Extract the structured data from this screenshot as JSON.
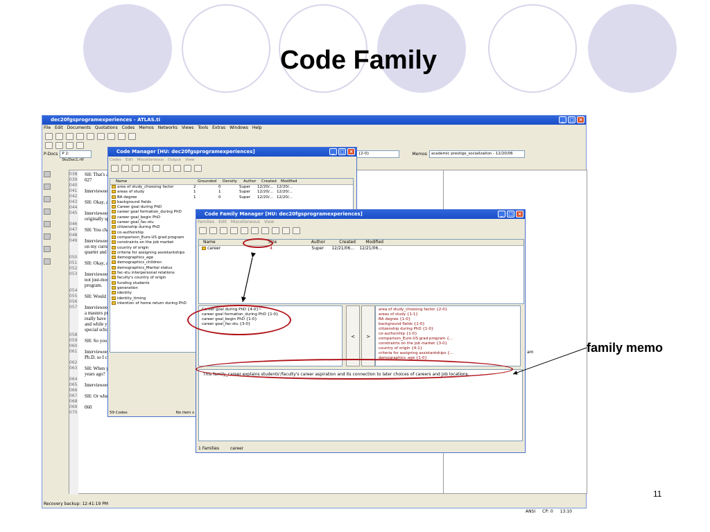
{
  "slide": {
    "title": "Code Family",
    "page_number": "11",
    "callout": "family memo"
  },
  "app": {
    "title": "dec20fgsprogramexperiences - ATLAS.ti",
    "menu": [
      "File",
      "Edit",
      "Documents",
      "Quotations",
      "Codes",
      "Memos",
      "Networks",
      "Views",
      "Tools",
      "Extras",
      "Windows",
      "Help"
    ],
    "pdocs_label": "P-Docs",
    "pdoc_value": "P 2: StuDoc1.rtf",
    "codes_combo": "area of study_choosing factor {2-0}",
    "memos_label": "Memos",
    "memo_combo": "academic prestige_socialization - 12/20/06",
    "status_left": "Recovery backup: 12:41:19 PM",
    "status_right": [
      "ANSI",
      "CP: 0",
      "13:10"
    ],
    "line_numbers": [
      "038",
      "039",
      "040",
      "041",
      "042",
      "043",
      "044",
      "045",
      "",
      "046",
      "047",
      "048",
      "049",
      "",
      "",
      "050",
      "051",
      "052",
      "053",
      "",
      "",
      "054",
      "055",
      "056",
      "057",
      "",
      "",
      "",
      "",
      "058",
      "059",
      "060",
      "061",
      "",
      "062",
      "063",
      "",
      "064",
      "065",
      "066",
      "067",
      "068",
      "069",
      "070"
    ],
    "doc_lines": [
      "SH: That's a",
      "027",
      "",
      "Interviewee:",
      "",
      "SH: Okay, ar",
      "",
      "Interviewee:",
      "originally spe",
      "",
      "SH: You cha",
      "",
      "Interviewee:",
      "on my curren",
      "quarter and t",
      "",
      "SH: Okay, ar",
      "",
      "Interviewee:",
      "not just-most",
      "program.",
      "",
      "SH: Would y",
      "",
      "Interviewee:",
      "a masters pro",
      "really have d",
      "and while yo",
      "special schoo",
      "",
      "SH: So you c",
      "",
      "Interviewee:",
      "Ph.D. so I came, yeah.",
      "",
      "SH: When you apply your, well, let me ask in th",
      "years ago?",
      "",
      "Interviewee: um (yes).",
      "",
      "SH: Or when you apply your MA even?",
      "",
      "060",
      ""
    ],
    "right_pane_fragment": "am"
  },
  "code_manager": {
    "title": "Code Manager [HU: dec20fgsprogramexperiences]",
    "menu": [
      "Codes",
      "Edit",
      "Miscellaneous",
      "Output",
      "View"
    ],
    "columns": [
      "Name",
      "Grounded",
      "Density",
      "Author",
      "Created",
      "Modified"
    ],
    "rows": [
      [
        "area of study_choosing factor",
        "2",
        "0",
        "Super",
        "12/20/...",
        "12/20/..."
      ],
      [
        "areas of study",
        "1",
        "1",
        "Super",
        "12/20/...",
        "12/20/..."
      ],
      [
        "BA degree",
        "1",
        "0",
        "Super",
        "12/20/...",
        "12/20/..."
      ],
      [
        "background fields",
        "",
        "",
        "",
        "",
        ""
      ],
      [
        "Career goal during PhD",
        "",
        "",
        "",
        "",
        ""
      ],
      [
        "career goal formation_during PhD",
        "",
        "",
        "",
        "",
        ""
      ],
      [
        "career goal_begin PhD",
        "",
        "",
        "",
        "",
        ""
      ],
      [
        "career goal_fac-stu",
        "",
        "",
        "",
        "",
        ""
      ],
      [
        "citizenship during PhD",
        "",
        "",
        "",
        "",
        ""
      ],
      [
        "co-authorship",
        "",
        "",
        "",
        "",
        ""
      ],
      [
        "comparison_Euro-US grad program",
        "",
        "",
        "",
        "",
        ""
      ],
      [
        "constraints on the job market",
        "",
        "",
        "",
        "",
        ""
      ],
      [
        "country of origin",
        "",
        "",
        "",
        "",
        ""
      ],
      [
        "criteria for assigning assistantships",
        "",
        "",
        "",
        "",
        ""
      ],
      [
        "demographics_age",
        "",
        "",
        "",
        "",
        ""
      ],
      [
        "demographics_children",
        "",
        "",
        "",
        "",
        ""
      ],
      [
        "demographics_Marital status",
        "",
        "",
        "",
        "",
        ""
      ],
      [
        "fac-stu interpersonal relations",
        "",
        "",
        "",
        "",
        ""
      ],
      [
        "faculty's country of origin",
        "",
        "",
        "",
        "",
        ""
      ],
      [
        "funding students",
        "",
        "",
        "",
        "",
        ""
      ],
      [
        "generation",
        "",
        "",
        "",
        "",
        ""
      ],
      [
        "identity",
        "",
        "",
        "",
        "",
        ""
      ],
      [
        "identity_timing",
        "",
        "",
        "",
        "",
        ""
      ],
      [
        "intention of home return during PhD",
        "",
        "",
        "",
        "",
        ""
      ]
    ],
    "status": [
      "59 Codes",
      "No item s"
    ]
  },
  "family_manager": {
    "title": "Code Family Manager [HU: dec20fgsprogramexperiences]",
    "menu": [
      "Families",
      "Edit",
      "Miscellaneous",
      "View"
    ],
    "columns": [
      "Name",
      "Size",
      "Author",
      "Created",
      "Modified"
    ],
    "row": [
      "career",
      "4",
      "Super",
      "12/21/06...",
      "12/21/06..."
    ],
    "members": [
      "Career goal during PhD {4-0}~",
      "career goal formation_during PhD {1-0}",
      "career goal_begin PhD {1-0}",
      "career goal_fac-stu {3-0}"
    ],
    "non_members": [
      "area of study_choosing factor {2-0}",
      "areas of study {1-1}",
      "BA degree {1-0}",
      "background fields {1-0}",
      "citizenship during PhD {1-0}",
      "co-authorship {1-0}",
      "comparison_Euro-US grad program {...",
      "constraints on the job market {3-0}",
      "country of origin {4-1}",
      "criteria for assigning assistantships {...",
      "demographics_age {1-0}"
    ],
    "move_left": "<",
    "move_right": ">",
    "memo_text": "This family_career explains students'/faculty's career aspiration and its connection to later choices of careers and job locations.",
    "status": [
      "1 Families",
      "career"
    ]
  }
}
